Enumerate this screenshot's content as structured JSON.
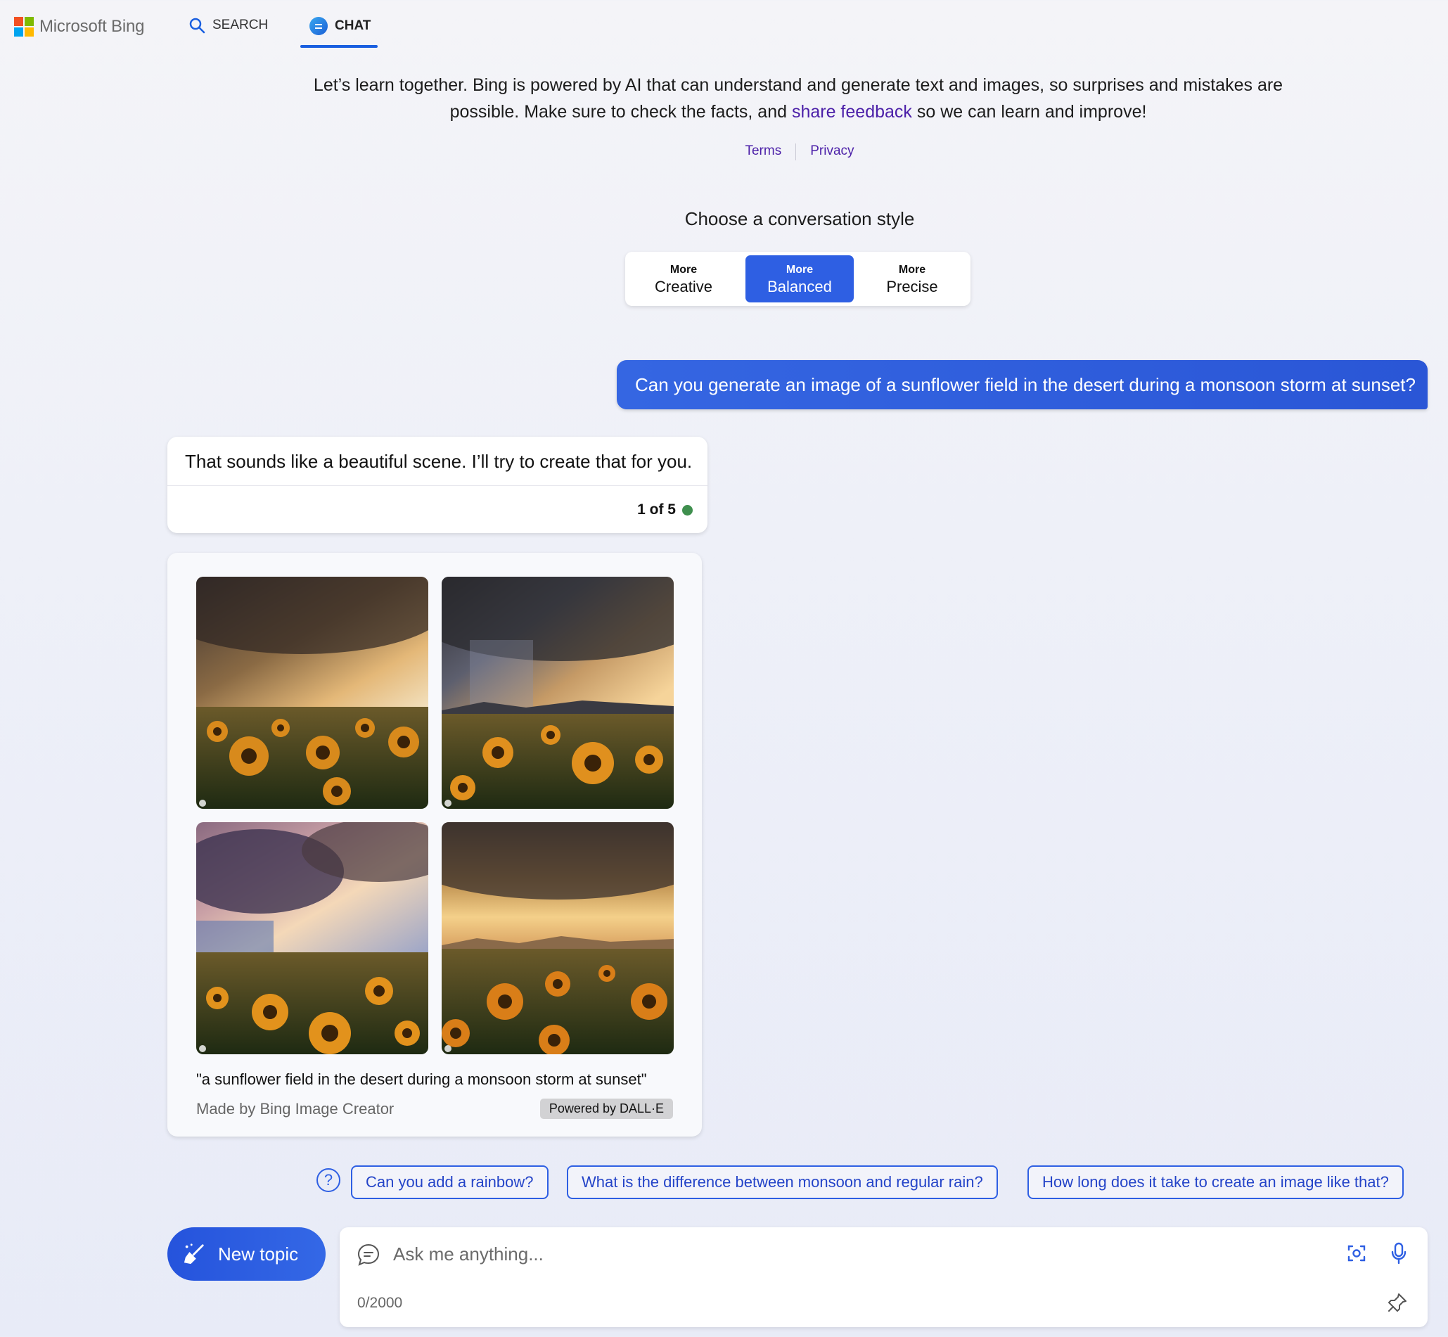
{
  "header": {
    "logo_text": "Microsoft Bing",
    "tabs": [
      {
        "label": "SEARCH",
        "icon": "search-icon"
      },
      {
        "label": "CHAT",
        "icon": "chat-bubble-icon",
        "active": true
      }
    ]
  },
  "intro": {
    "text_before": "Let’s learn together. Bing is powered by AI that can understand and generate text and images, so surprises and mistakes are possible. Make sure to check the facts, and ",
    "link_text": "share feedback",
    "text_after": " so we can learn and improve!",
    "terms": "Terms",
    "privacy": "Privacy"
  },
  "style_picker": {
    "title": "Choose a conversation style",
    "options": [
      {
        "small": "More",
        "big": "Creative"
      },
      {
        "small": "More",
        "big": "Balanced",
        "selected": true
      },
      {
        "small": "More",
        "big": "Precise"
      }
    ]
  },
  "conversation": {
    "user_message": "Can you generate an image of a sunflower field in the desert during a monsoon storm at sunset?",
    "bot_message": "That sounds like a beautiful scene. I’ll try to create that for you.",
    "turn_counter": "1 of 5",
    "image_card": {
      "caption": "\"a sunflower field in the desert during a monsoon storm at sunset\"",
      "made_by": "Made by Bing Image Creator",
      "powered_by": "Powered by DALL·E"
    }
  },
  "suggestions": [
    "Can you add a rainbow?",
    "What is the difference between monsoon and regular rain?",
    "How long does it take to create an image like that?"
  ],
  "composer": {
    "new_topic_label": "New topic",
    "placeholder": "Ask me anything...",
    "char_counter": "0/2000"
  },
  "colors": {
    "accent": "#2e5fe3",
    "link": "#4b1fa8",
    "status_green": "#3f8f4e"
  }
}
